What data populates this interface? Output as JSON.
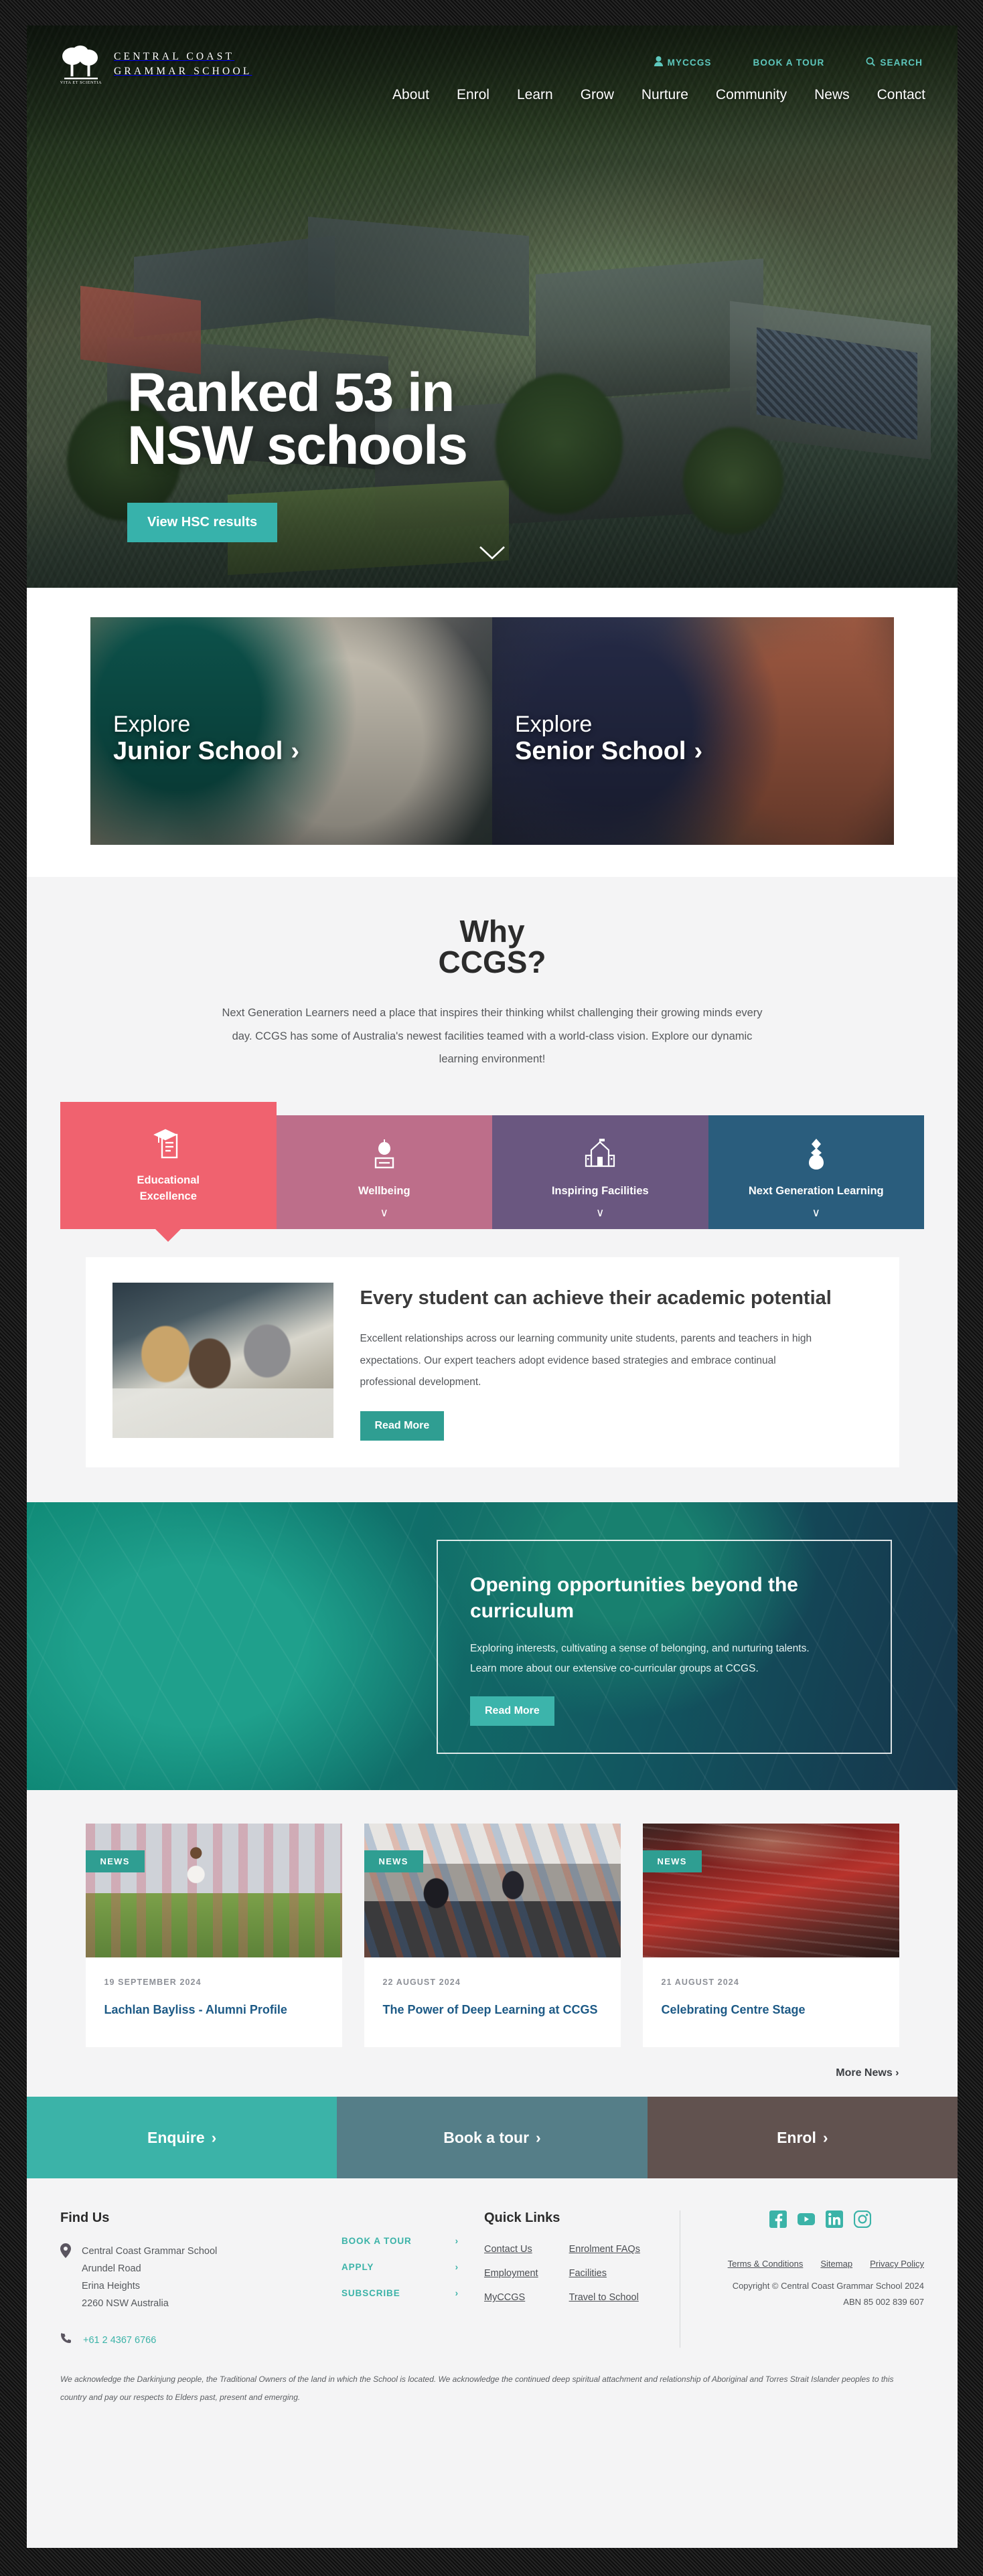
{
  "header": {
    "logo_line1": "CENTRAL COAST",
    "logo_line2": "GRAMMAR SCHOOL",
    "logo_motto": "VITA ET SCIENTIA",
    "utility": [
      {
        "label": "MYCCGS",
        "icon": "user-icon"
      },
      {
        "label": "BOOK A TOUR",
        "icon": "none"
      },
      {
        "label": "SEARCH",
        "icon": "search-icon"
      }
    ],
    "nav": [
      "About",
      "Enrol",
      "Learn",
      "Grow",
      "Nurture",
      "Community",
      "News",
      "Contact"
    ]
  },
  "hero": {
    "heading_line1": "Ranked 53 in",
    "heading_line2": "NSW schools",
    "button": "View HSC results",
    "scroll_icon": "chevron-down-icon",
    "button_color": "#37b2ab"
  },
  "explore": [
    {
      "small": "Explore",
      "big": "Junior School",
      "chevron": "›"
    },
    {
      "small": "Explore",
      "big": "Senior School",
      "chevron": "›"
    }
  ],
  "why": {
    "title_line1": "Why",
    "title_line2": "CCGS?",
    "lead_line1": "Next Generation Learners need a place that inspires their thinking whilst challenging their growing",
    "lead_line2": "minds every day. CCGS has some of Australia's newest facilities teamed with a world-class vision.",
    "lead_line3": "Explore our dynamic learning environment!",
    "tabs": [
      {
        "label_line1": "Educational",
        "label_line2": "Excellence",
        "color": "#f0626f",
        "icon": "graduation-certificate-icon",
        "active": true
      },
      {
        "label_line1": "Wellbeing",
        "label_line2": "",
        "color": "#bd6e8a",
        "icon": "apple-book-icon",
        "active": false,
        "chevron": "∨"
      },
      {
        "label_line1": "Inspiring Facilities",
        "label_line2": "",
        "color": "#6a5780",
        "icon": "school-building-icon",
        "active": false,
        "chevron": "∨"
      },
      {
        "label_line1": "Next Generation Learning",
        "label_line2": "",
        "color": "#2a5d7d",
        "icon": "lightbulb-icon",
        "active": false,
        "chevron": "∨"
      }
    ],
    "panel": {
      "title": "Every student can achieve their academic potential",
      "body_line1": "Excellent relationships across our learning community unite students, parents and teachers in",
      "body_line2": "high expectations. Our expert teachers adopt evidence based strategies and embrace continual",
      "body_line3": "professional development.",
      "button": "Read More",
      "button_color": "#2f9e92"
    }
  },
  "opportunity": {
    "title_line1": "Opening opportunities beyond the",
    "title_line2": "curriculum",
    "body_line1": "Exploring interests, cultivating a sense of belonging, and nurturing talents.",
    "body_line2": "Learn more about our extensive co-curricular groups at CCGS.",
    "button": "Read More",
    "button_color": "#3cb4ab"
  },
  "news": {
    "badge": "NEWS",
    "items": [
      {
        "date": "19 SEPTEMBER 2024",
        "title": "Lachlan Bayliss - Alumni Profile"
      },
      {
        "date": "22 AUGUST 2024",
        "title": "The Power of Deep Learning at CCGS"
      },
      {
        "date": "21 AUGUST 2024",
        "title": "Celebrating Centre Stage"
      }
    ],
    "more_label": "More News",
    "more_chevron": "›"
  },
  "cta_bar": [
    {
      "label": "Enquire",
      "chevron": "›",
      "color": "#3bb3a8"
    },
    {
      "label": "Book a tour",
      "chevron": "›",
      "color": "#557e88"
    },
    {
      "label": "Enrol",
      "chevron": "›",
      "color": "#61524f"
    }
  ],
  "footer": {
    "find_us_heading": "Find Us",
    "address": [
      "Central Coast Grammar School",
      "Arundel Road",
      "Erina Heights",
      "2260 NSW Australia"
    ],
    "phone": "+61 2 4367 6766",
    "cta_links": [
      "BOOK A TOUR",
      "APPLY",
      "SUBSCRIBE"
    ],
    "cta_chevron": "›",
    "quick_links_heading": "Quick Links",
    "quick_links_col1": [
      "Contact Us",
      "Employment",
      "MyCCGS"
    ],
    "quick_links_col2": [
      "Enrolment FAQs",
      "Facilities",
      "Travel to School"
    ],
    "socials": [
      "facebook-icon",
      "youtube-icon",
      "linkedin-icon",
      "instagram-icon"
    ],
    "social_color": "#3bb3a8",
    "legal_links": [
      "Terms & Conditions",
      "Sitemap",
      "Privacy Policy"
    ],
    "copyright": "Copyright © Central Coast Grammar School 2024",
    "abn": "ABN 85 002 839 607",
    "acknowledgement_line1": "We acknowledge the Darkinjung people, the Traditional Owners of the land in which the School is located. We acknowledge the continued deep spiritual attachment and relationship of Aboriginal and Torres Strait Islander peoples to this",
    "acknowledgement_line2": "country and pay our respects to Elders past, present and emerging."
  }
}
